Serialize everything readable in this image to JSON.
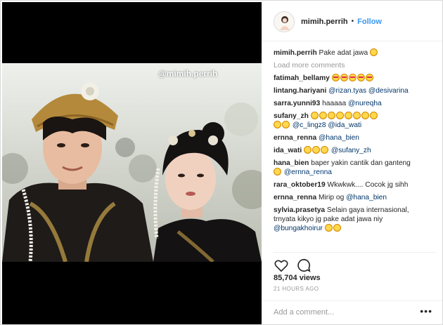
{
  "post": {
    "username": "mimih.perrih",
    "follow_label": "Follow",
    "dot": "•",
    "watermark": "@mimih.perrih",
    "caption_user": "mimih.perrih",
    "caption_text": "Pake adat jawa",
    "load_more": "Load more comments",
    "views": "85,704 views",
    "time_ago": "21 HOURS AGO",
    "add_comment_placeholder": "Add a comment...",
    "more_options": "•••"
  },
  "comments": [
    {
      "user": "fatimah_bellamy",
      "parts": [],
      "emoji": 5,
      "emoji_type": "heart"
    },
    {
      "user": "lintang.hariyani",
      "parts": [
        {
          "m": "@rizan.tyas"
        },
        {
          "m": "@desivarina"
        }
      ],
      "emoji": 0
    },
    {
      "user": "sarra.yunni93",
      "text": "haaaaa",
      "parts": [
        {
          "m": "@nureqha"
        }
      ],
      "emoji": 0
    },
    {
      "user": "sufany_zh",
      "parts": [],
      "emoji": 8,
      "emoji_type": "laugh",
      "line2_emoji": 2,
      "line2_parts": [
        {
          "m": "@c_lingz8"
        },
        {
          "m": "@ida_wati"
        }
      ]
    },
    {
      "user": "ernna_renna",
      "parts": [
        {
          "m": "@hana_bien"
        }
      ],
      "emoji": 0
    },
    {
      "user": "ida_wati",
      "parts": [
        {
          "m": "@sufany_zh"
        }
      ],
      "emoji": 3,
      "emoji_type": "laugh",
      "emoji_first": true
    },
    {
      "user": "hana_bien",
      "text": "baper yakin cantik dan ganteng",
      "parts": [],
      "emoji": 0,
      "line2_emoji": 1,
      "line2_parts": [
        {
          "m": "@ernna_renna"
        }
      ]
    },
    {
      "user": "rara_oktober19",
      "text": "Wkwkwk.... Cocok jg sihh",
      "parts": [],
      "emoji": 0
    },
    {
      "user": "ernna_renna",
      "text": "Mirip og",
      "parts": [
        {
          "m": "@hana_bien"
        }
      ],
      "emoji": 0
    },
    {
      "user": "sylvia.prasetya",
      "text": "Selain gaya internasional, trnyata kikyo jg pake adat jawa niy",
      "parts": [],
      "emoji": 0,
      "line2_text": "trnyata kikyo jg pake adat jawa niy",
      "line1_text": "Selain gaya internasional,",
      "line3_parts": [
        {
          "m": "@bungakhoirur"
        }
      ],
      "line3_emoji": 2
    }
  ],
  "icons": {
    "like": "heart-outline-icon",
    "comment": "comment-bubble-icon",
    "avatar": "profile-avatar"
  },
  "colors": {
    "link": "#3897f0",
    "mention": "#003569",
    "muted": "#999999"
  }
}
